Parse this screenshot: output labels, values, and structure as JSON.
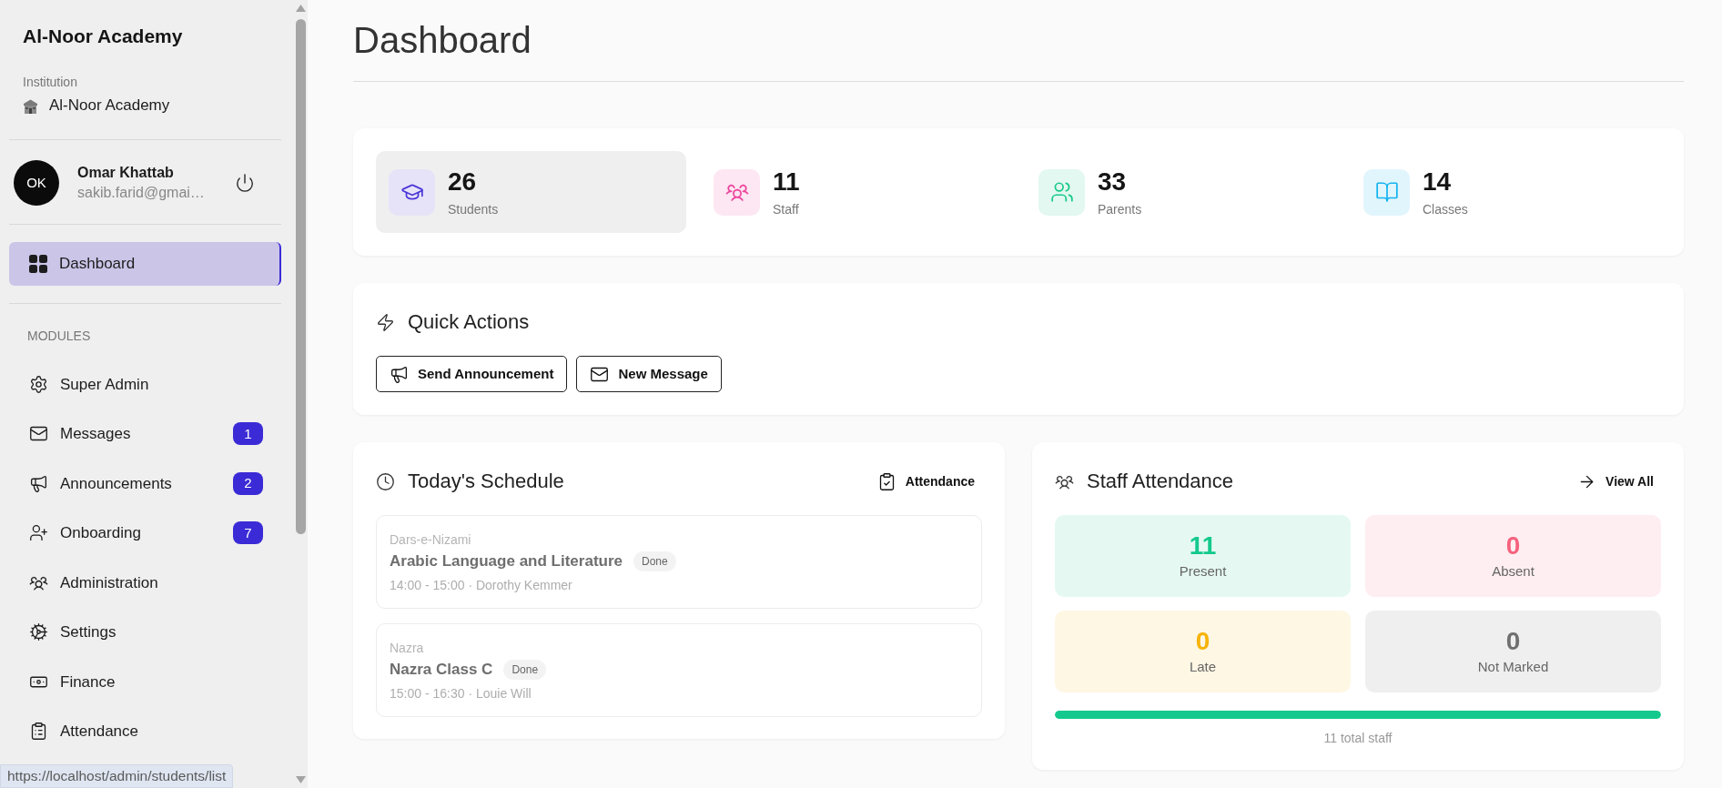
{
  "sidebar": {
    "brand": "Al-Noor Academy",
    "institution": {
      "label": "Institution",
      "name": "Al-Noor Academy"
    },
    "user": {
      "initials": "OK",
      "name": "Omar Khattab",
      "email": "sakib.farid@gmai…"
    },
    "dashboard": {
      "label": "Dashboard",
      "selected": true
    },
    "modules": {
      "heading": "MODULES",
      "items": [
        {
          "label": "Super Admin",
          "selected": false
        },
        {
          "label": "Messages",
          "badge": "1",
          "selected": false
        },
        {
          "label": "Announcements",
          "badge": "2",
          "selected": false
        },
        {
          "label": "Onboarding",
          "badge": "7",
          "selected": false
        },
        {
          "label": "Administration",
          "selected": false
        },
        {
          "label": "Settings",
          "selected": false
        },
        {
          "label": "Finance",
          "selected": false
        },
        {
          "label": "Attendance",
          "selected": false
        }
      ]
    }
  },
  "page": {
    "title": "Dashboard"
  },
  "stats": [
    {
      "value": "26",
      "label": "Students",
      "selected": true
    },
    {
      "value": "11",
      "label": "Staff",
      "selected": false
    },
    {
      "value": "33",
      "label": "Parents",
      "selected": false
    },
    {
      "value": "14",
      "label": "Classes",
      "selected": false
    }
  ],
  "quick_actions": {
    "title": "Quick Actions",
    "buttons": [
      {
        "label": "Send Announcement"
      },
      {
        "label": "New Message"
      }
    ]
  },
  "schedule": {
    "title": "Today's Schedule",
    "link": "Attendance",
    "items": [
      {
        "group": "Dars-e-Nizami",
        "title": "Arabic Language and Literature",
        "status": "Done",
        "completed": true,
        "time": "14:00 - 15:00 · Dorothy Kemmer"
      },
      {
        "group": "Nazra",
        "title": "Nazra Class C",
        "status": "Done",
        "completed": true,
        "time": "15:00 - 16:30 · Louie Will"
      }
    ]
  },
  "staff_attendance": {
    "title": "Staff Attendance",
    "link": "View All",
    "tiles": [
      {
        "value": "11",
        "label": "Present",
        "color": "#14c98d"
      },
      {
        "value": "0",
        "label": "Absent",
        "color": "#f6617d"
      },
      {
        "value": "0",
        "label": "Late",
        "color": "#f7b307"
      },
      {
        "value": "0",
        "label": "Not Marked",
        "color": "#707070"
      }
    ],
    "progress": {
      "level": 1
    },
    "total": "11 total staff"
  },
  "status_url": "https://localhost/admin/students/list"
}
